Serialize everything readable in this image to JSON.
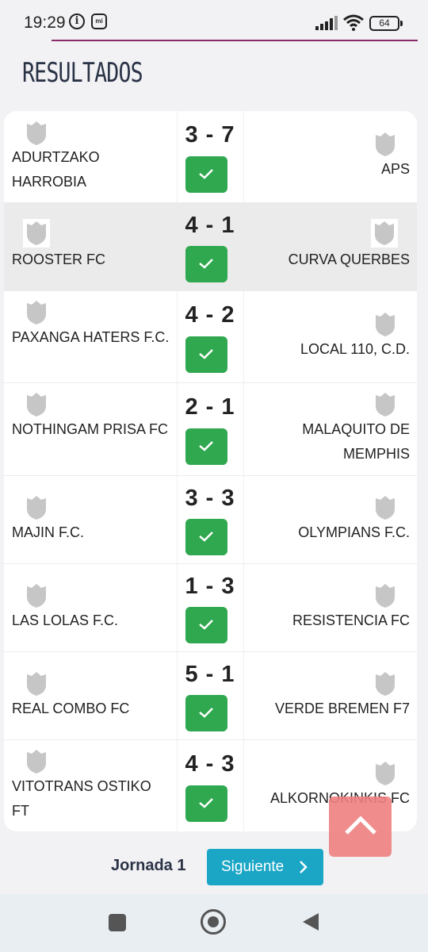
{
  "status_bar": {
    "time": "19:29",
    "battery": "64"
  },
  "page": {
    "title": "RESULTADOS"
  },
  "matches": [
    {
      "home": "ADURTZAKO HARROBIA",
      "away": "APS",
      "score": "3 - 7"
    },
    {
      "home": "ROOSTER FC",
      "away": "CURVA QUERBES",
      "score": "4 - 1"
    },
    {
      "home": "PAXANGA HATERS F.C.",
      "away": "LOCAL 110, C.D.",
      "score": "4 - 2"
    },
    {
      "home": "NOTHINGAM PRISA FC",
      "away": "MALAQUITO DE MEMPHIS",
      "score": "2 - 1"
    },
    {
      "home": "MAJIN F.C.",
      "away": "OLYMPIANS F.C.",
      "score": "3 - 3"
    },
    {
      "home": "LAS LOLAS F.C.",
      "away": "RESISTENCIA FC",
      "score": "1 - 3"
    },
    {
      "home": "REAL COMBO FC",
      "away": "VERDE BREMEN F7",
      "score": "5 - 1"
    },
    {
      "home": "VITOTRANS OSTIKO FT",
      "away": "ALKORNOKINKIS FC",
      "score": "4 - 3"
    }
  ],
  "footer": {
    "round_label": "Jornada 1",
    "next_label": "Siguiente"
  },
  "icons": {
    "crest": "shield-icon",
    "status": "check-icon",
    "scroll_top": "chevron-up-icon",
    "next": "chevron-right-icon"
  },
  "colors": {
    "check_green": "#2fa84f",
    "next_blue": "#1ba6c6",
    "scroll_top": "#f08080",
    "title": "#2a3246",
    "accent_line": "#8a2b6a"
  }
}
